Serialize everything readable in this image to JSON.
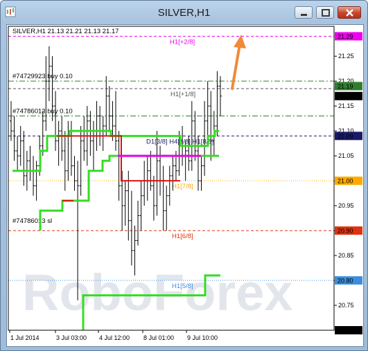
{
  "window": {
    "title": "SILVER,H1"
  },
  "chart": {
    "header": "SILVER,H1  21.13 21.21 21.13 21.17",
    "watermark": "RoboForex",
    "colors": {
      "candles": "#000000",
      "lime": "#33dd22",
      "red": "#dd1111",
      "magenta": "#ee00ee",
      "arrow": "#f08a3a",
      "grid": "#000000"
    }
  },
  "chart_data": {
    "type": "candlestick",
    "ylim": [
      20.7,
      21.31
    ],
    "y_ticks": [
      "21.25",
      "21.20",
      "21.15",
      "21.10",
      "21.05",
      "21.00",
      "20.95",
      "20.90",
      "20.85",
      "20.80",
      "20.75"
    ],
    "x_ticks": [
      "1 Jul 2014",
      "3 Jul 03:00",
      "4 Jul 12:00",
      "8 Jul 01:00",
      "9 Jul 10:00"
    ],
    "price_labels": [
      {
        "value": 21.29,
        "text": "21.29",
        "color": "#ee00ee"
      },
      {
        "value": 21.19,
        "text": "21.19",
        "color": "#2f7f2f"
      },
      {
        "value": 21.17,
        "text": "21.17",
        "color": "#000000"
      },
      {
        "value": 21.09,
        "text": "21.09",
        "color": "#1a1a6a"
      },
      {
        "value": 21.0,
        "text": "21.00",
        "color": "#ffaa00"
      },
      {
        "value": 20.9,
        "text": "20.90",
        "color": "#dd3311"
      },
      {
        "value": 20.8,
        "text": "20.80",
        "color": "#3a8edc"
      },
      {
        "value": 20.7,
        "text": "20.70",
        "color": "#000000"
      }
    ],
    "levels": [
      {
        "value": 21.29,
        "label": "H1[+2/8]",
        "color": "#ee00ee",
        "style": "dash"
      },
      {
        "value": 21.2,
        "label": "",
        "color": "#2f7f2f",
        "style": "dashdot"
      },
      {
        "value": 21.185,
        "label": "H1[+1/8]",
        "color": "#555555",
        "style": "dash"
      },
      {
        "value": 21.13,
        "label": "",
        "color": "#2f7f2f",
        "style": "dashdot"
      },
      {
        "value": 21.09,
        "label": "D1[3/8] H4[8/8] H1[8/8]",
        "color": "#1a1a6a",
        "style": "dash"
      },
      {
        "value": 21.0,
        "label": "H1[7/8]",
        "color": "#ffaa00",
        "style": "dot"
      },
      {
        "value": 20.9,
        "label": "H1[6/8]",
        "color": "#dd3311",
        "style": "dash"
      },
      {
        "value": 20.8,
        "label": "H1[5/8]",
        "color": "#3a8edc",
        "style": "dot"
      }
    ],
    "orders": [
      {
        "value": 21.2,
        "text": "#74729923 buy 0.10"
      },
      {
        "value": 21.13,
        "text": "#74786013 buy 0.10"
      },
      {
        "value": 20.91,
        "text": "#74786013 sl"
      }
    ],
    "bars": [
      [
        21.12,
        21.16,
        21.08,
        21.1
      ],
      [
        21.1,
        21.13,
        21.04,
        21.06
      ],
      [
        21.06,
        21.09,
        21.02,
        21.05
      ],
      [
        21.05,
        21.11,
        21.03,
        21.08
      ],
      [
        21.08,
        21.1,
        20.99,
        21.01
      ],
      [
        21.01,
        21.06,
        20.98,
        21.04
      ],
      [
        21.04,
        21.07,
        21.0,
        21.02
      ],
      [
        21.02,
        21.05,
        20.97,
        20.99
      ],
      [
        20.99,
        21.04,
        20.96,
        21.03
      ],
      [
        21.03,
        21.09,
        21.01,
        21.07
      ],
      [
        21.07,
        21.14,
        21.05,
        21.12
      ],
      [
        21.12,
        21.25,
        21.1,
        21.2
      ],
      [
        21.2,
        21.27,
        21.16,
        21.23
      ],
      [
        21.23,
        21.25,
        21.12,
        21.15
      ],
      [
        21.15,
        21.18,
        21.06,
        21.08
      ],
      [
        21.08,
        21.12,
        21.03,
        21.1
      ],
      [
        21.1,
        21.13,
        21.04,
        21.06
      ],
      [
        21.06,
        21.1,
        20.98,
        21.02
      ],
      [
        21.02,
        21.12,
        21.0,
        21.1
      ],
      [
        21.1,
        21.12,
        21.01,
        21.03
      ],
      [
        21.03,
        21.05,
        20.98,
        21.0
      ],
      [
        21.0,
        21.04,
        20.76,
        20.99
      ],
      [
        20.99,
        21.11,
        20.97,
        21.08
      ],
      [
        21.08,
        21.13,
        21.04,
        21.06
      ],
      [
        21.06,
        21.15,
        21.03,
        21.12
      ],
      [
        21.12,
        21.14,
        21.05,
        21.08
      ],
      [
        21.08,
        21.12,
        21.02,
        21.1
      ],
      [
        21.1,
        21.16,
        21.06,
        21.13
      ],
      [
        21.13,
        21.15,
        21.07,
        21.1
      ],
      [
        21.1,
        21.13,
        21.06,
        21.11
      ],
      [
        21.11,
        21.21,
        21.09,
        21.17
      ],
      [
        21.17,
        21.19,
        21.1,
        21.13
      ],
      [
        21.13,
        21.16,
        21.08,
        21.11
      ],
      [
        21.11,
        21.18,
        21.06,
        21.08
      ],
      [
        21.08,
        21.1,
        20.96,
        20.99
      ],
      [
        20.99,
        21.02,
        20.9,
        20.95
      ],
      [
        20.95,
        21.0,
        20.91,
        20.98
      ],
      [
        20.98,
        21.02,
        20.88,
        20.92
      ],
      [
        20.92,
        20.98,
        20.83,
        20.86
      ],
      [
        20.86,
        20.91,
        20.81,
        20.88
      ],
      [
        20.88,
        20.96,
        20.87,
        20.93
      ],
      [
        20.93,
        21.0,
        20.9,
        20.97
      ],
      [
        20.97,
        21.04,
        20.95,
        21.0
      ],
      [
        21.0,
        21.05,
        20.96,
        21.02
      ],
      [
        21.02,
        21.06,
        20.98,
        20.99
      ],
      [
        20.99,
        21.01,
        20.92,
        20.95
      ],
      [
        20.95,
        21.1,
        20.93,
        21.04
      ],
      [
        21.04,
        21.07,
        20.97,
        21.0
      ],
      [
        21.0,
        21.03,
        20.9,
        20.94
      ],
      [
        20.94,
        20.99,
        20.9,
        20.97
      ],
      [
        20.97,
        21.03,
        20.95,
        21.01
      ],
      [
        21.01,
        21.05,
        20.98,
        21.03
      ],
      [
        21.03,
        21.06,
        21.0,
        21.02
      ],
      [
        21.02,
        21.1,
        21.01,
        21.08
      ],
      [
        21.08,
        21.11,
        21.03,
        21.05
      ],
      [
        21.05,
        21.08,
        21.0,
        21.06
      ],
      [
        21.06,
        21.09,
        21.02,
        21.04
      ],
      [
        21.04,
        21.16,
        21.02,
        21.12
      ],
      [
        21.12,
        21.14,
        21.04,
        21.06
      ],
      [
        21.06,
        21.09,
        20.98,
        21.0
      ],
      [
        21.0,
        21.05,
        20.98,
        21.03
      ],
      [
        21.03,
        21.16,
        21.01,
        21.12
      ],
      [
        21.12,
        21.2,
        21.09,
        21.15
      ],
      [
        21.15,
        21.18,
        21.04,
        21.08
      ],
      [
        21.08,
        21.14,
        21.05,
        21.11
      ],
      [
        21.11,
        21.22,
        21.09,
        21.19
      ],
      [
        21.19,
        21.21,
        21.13,
        21.17
      ]
    ]
  }
}
